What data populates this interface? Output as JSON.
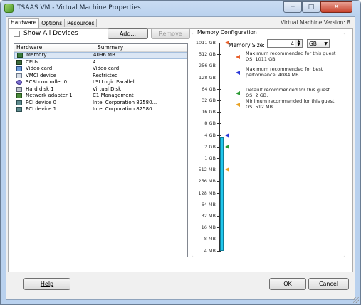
{
  "window": {
    "title": "TSAAS VM - Virtual Machine Properties",
    "controls": {
      "minimize": "─",
      "maximize": "□",
      "close": "✕"
    }
  },
  "tabs": [
    "Hardware",
    "Options",
    "Resources"
  ],
  "vm_version": "Virtual Machine Version: 8",
  "hardware": {
    "show_all_label": "Show All Devices",
    "add_label": "Add...",
    "remove_label": "Remove",
    "columns": [
      "Hardware",
      "Summary"
    ],
    "rows": [
      {
        "icon": "memory-icon",
        "name": "Memory",
        "summary": "4096 MB"
      },
      {
        "icon": "cpu-icon",
        "name": "CPUs",
        "summary": "4"
      },
      {
        "icon": "video-card-icon",
        "name": "Video card",
        "summary": "Video card"
      },
      {
        "icon": "vmci-device-icon",
        "name": "VMCI device",
        "summary": "Restricted"
      },
      {
        "icon": "scsi-controller-icon",
        "name": "SCSI controller 0",
        "summary": "LSI Logic Parallel"
      },
      {
        "icon": "hard-disk-icon",
        "name": "Hard disk 1",
        "summary": "Virtual Disk"
      },
      {
        "icon": "network-adapter-icon",
        "name": "Network adapter 1",
        "summary": "C1 Management"
      },
      {
        "icon": "pci-device-icon",
        "name": "PCI device 0",
        "summary": "Intel Corporation 82580..."
      },
      {
        "icon": "pci-device-icon",
        "name": "PCI device 1",
        "summary": "Intel Corporation 82580..."
      }
    ]
  },
  "memory": {
    "group_title": "Memory Configuration",
    "size_label": "Memory Size:",
    "size_value": "4",
    "unit": "GB",
    "scale": [
      "1011 GB",
      "512 GB",
      "256 GB",
      "128 GB",
      "64 GB",
      "32 GB",
      "16 GB",
      "8 GB",
      "4 GB",
      "2 GB",
      "1 GB",
      "512 MB",
      "256 MB",
      "128 MB",
      "64 MB",
      "32 MB",
      "16 MB",
      "8 MB",
      "4 MB"
    ],
    "legend": [
      {
        "color": "#e8602c",
        "text": "Maximum recommended for this guest OS: 1011 GB."
      },
      {
        "color": "#2836d8",
        "text": "Maximum recommended for best performance: 4084 MB."
      },
      {
        "color": "#2a9a32",
        "text": "Default recommended for this guest OS: 2 GB."
      },
      {
        "color": "#e8a020",
        "text": "Minimum recommended for this guest OS: 512 MB."
      }
    ]
  },
  "footer": {
    "help": "Help",
    "ok": "OK",
    "cancel": "Cancel"
  }
}
